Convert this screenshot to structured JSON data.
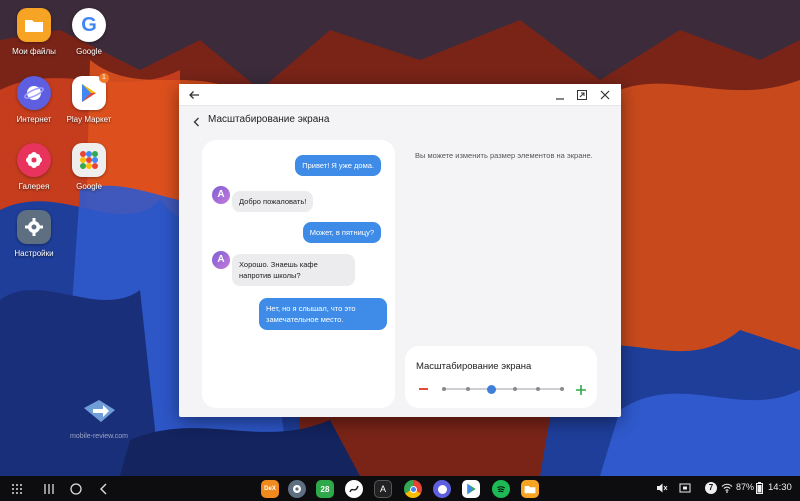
{
  "desktop": {
    "icons": [
      {
        "label": "Мои файлы",
        "icon": "folder-icon"
      },
      {
        "label": "Google",
        "icon": "google-icon"
      },
      {
        "label": "Интернет",
        "icon": "samsung-internet-icon"
      },
      {
        "label": "Play Маркет",
        "icon": "play-store-icon",
        "badge": "1"
      },
      {
        "label": "Галерея",
        "icon": "gallery-flower-icon"
      },
      {
        "label": "Google",
        "icon": "google-apps-folder-icon"
      },
      {
        "label": "Настройки",
        "icon": "settings-gear-icon"
      }
    ],
    "watermark": "mobile-review.com"
  },
  "window": {
    "title": "Масштабирование экрана",
    "description": "Вы можете изменить размер элементов на экране.",
    "chat": [
      {
        "dir": "out",
        "text": "Привет! Я уже дома."
      },
      {
        "dir": "in",
        "text": "Добро пожаловать!",
        "avatar": "A"
      },
      {
        "dir": "out",
        "text": "Может, в пятницу?"
      },
      {
        "dir": "in",
        "text": "Хорошо. Знаешь кафе напротив школы?",
        "avatar": "A"
      },
      {
        "dir": "out",
        "text": "Нет, но я слышал, что это замечательное место."
      }
    ],
    "zoom": {
      "label": "Масштабирование экрана",
      "level": 2,
      "steps": 6
    }
  },
  "taskbar": {
    "battery": "87%",
    "time": "14:30",
    "notification_count": "7",
    "dock": [
      "dex-icon",
      "settings-icon",
      "calendar-icon",
      "pen-icon",
      "a-icon",
      "chrome-icon",
      "internet-icon",
      "play-store-icon",
      "spotify-icon",
      "folder-icon"
    ],
    "calendar_day": "28"
  },
  "colors": {
    "accent": "#3e8ce8",
    "minus": "#e04b3a",
    "plus": "#2ea84a"
  }
}
